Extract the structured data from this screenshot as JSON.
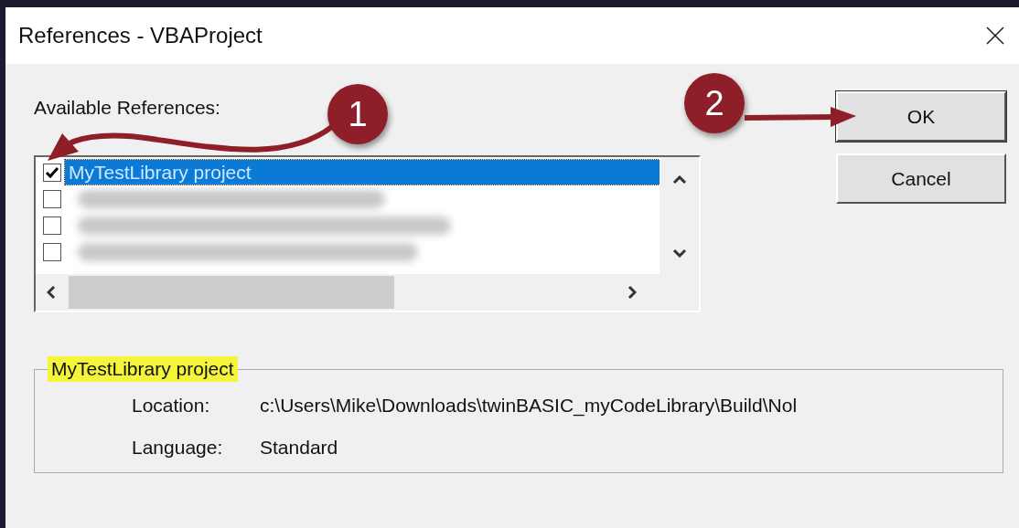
{
  "window": {
    "title": "References - VBAProject"
  },
  "available_label": "Available References:",
  "references": [
    {
      "kind": "item",
      "label": "MyTestLibrary project",
      "checked": true,
      "selected": true
    },
    {
      "kind": "redacted",
      "checked": false,
      "selected": false
    },
    {
      "kind": "redacted",
      "checked": false,
      "selected": false
    },
    {
      "kind": "redacted",
      "checked": false,
      "selected": false
    }
  ],
  "buttons": [
    {
      "label": "OK",
      "default": true
    },
    {
      "label": "Cancel",
      "default": false
    }
  ],
  "details": {
    "title": "MyTestLibrary project",
    "fields": [
      {
        "label": "Location:",
        "value": "c:\\Users\\Mike\\Downloads\\twinBASIC_myCodeLibrary\\Build\\Nol"
      },
      {
        "label": "Language:",
        "value": "Standard"
      }
    ]
  },
  "annotations": [
    {
      "label": "1",
      "kind": "curved"
    },
    {
      "label": "2",
      "kind": "straight"
    }
  ]
}
